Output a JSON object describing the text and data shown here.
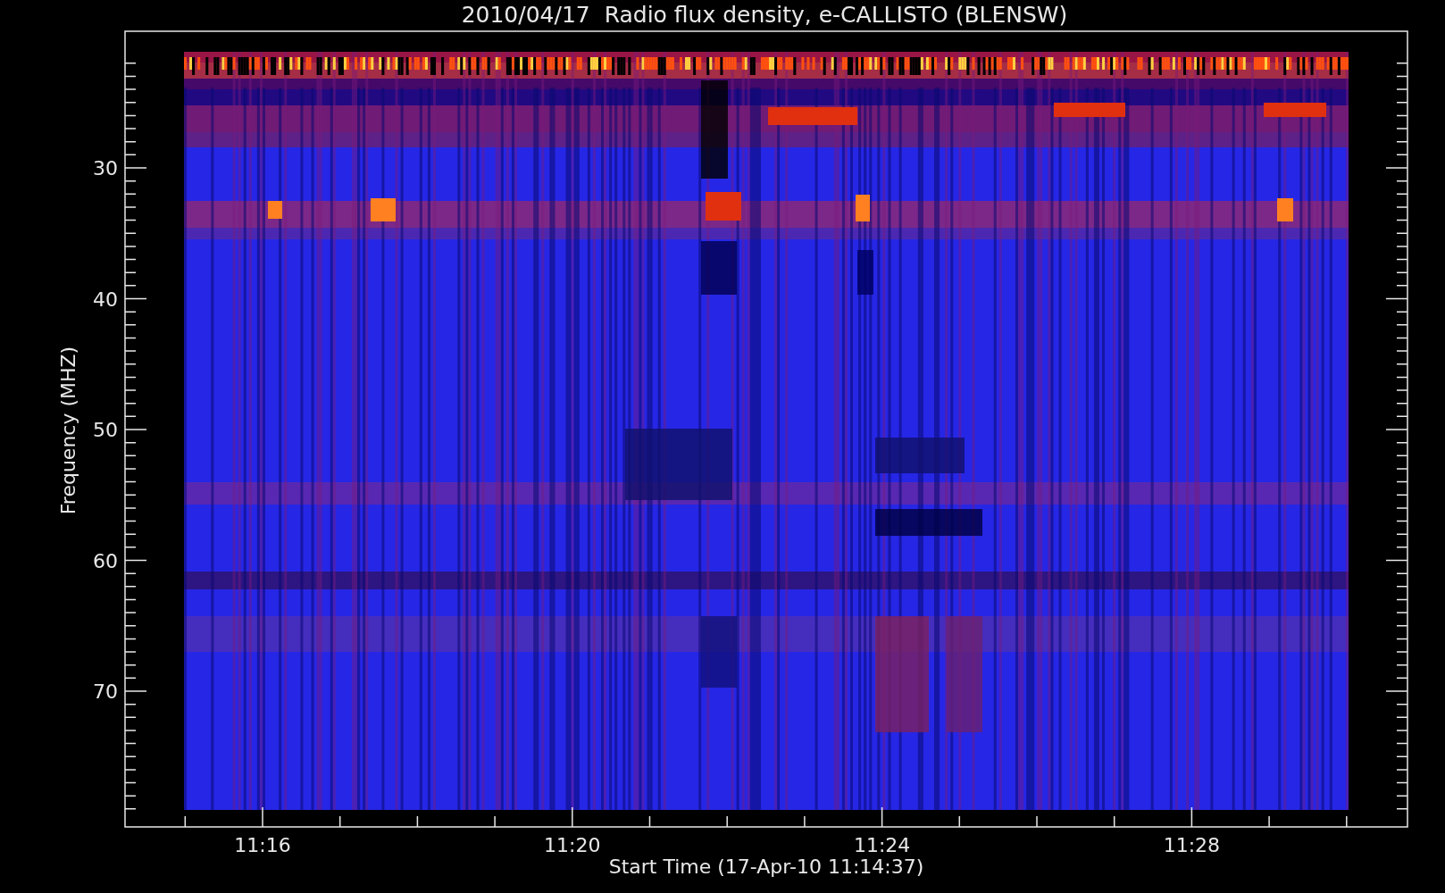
{
  "title": "2010/04/17  Radio flux density, e-CALLISTO (BLENSW)",
  "y_axis": {
    "label": "Frequency (MHZ)",
    "ticks": [
      "30",
      "40",
      "50",
      "60",
      "70"
    ]
  },
  "x_axis": {
    "label": "Start Time (17-Apr-10 11:14:37)",
    "ticks": [
      "11:16",
      "11:20",
      "11:24",
      "11:28"
    ]
  }
}
